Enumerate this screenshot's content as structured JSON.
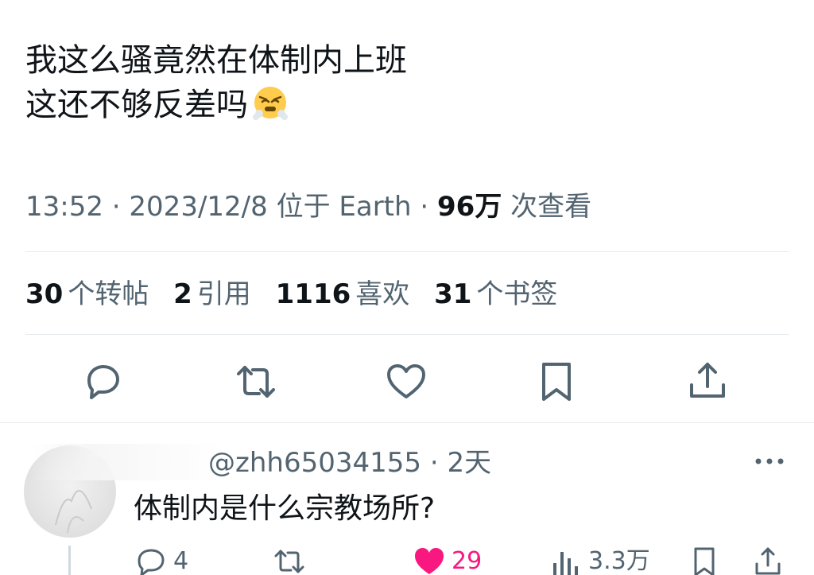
{
  "tweet": {
    "line1": "我这么骚竟然在体制内上班",
    "line2": "这还不够反差吗",
    "emoji": "face-with-steam-from-nose"
  },
  "meta": {
    "time": "13:52",
    "date": "2023/12/8",
    "location": "位于 Earth",
    "views": "96万",
    "views_suffix": "次查看",
    "sep": "·"
  },
  "stats": {
    "retweets": "30",
    "retweets_label": "个转帖",
    "quotes": "2",
    "quotes_label": "引用",
    "likes": "1116",
    "likes_label": "喜欢",
    "bookmarks": "31",
    "bookmarks_label": "个书签"
  },
  "actions": {
    "icons": [
      "reply-icon",
      "retweet-icon",
      "like-icon",
      "bookmark-icon",
      "share-icon"
    ]
  },
  "reply": {
    "handle": "@zhh65034155",
    "sep": "·",
    "time": "2天",
    "text": "体制内是什么宗教场所?",
    "reply_count": "4",
    "like_count": "29",
    "views": "3.3万"
  },
  "colors": {
    "text": "#0f1419",
    "secondary": "#536471",
    "like": "#f91880",
    "divider": "#e6e9eb"
  }
}
